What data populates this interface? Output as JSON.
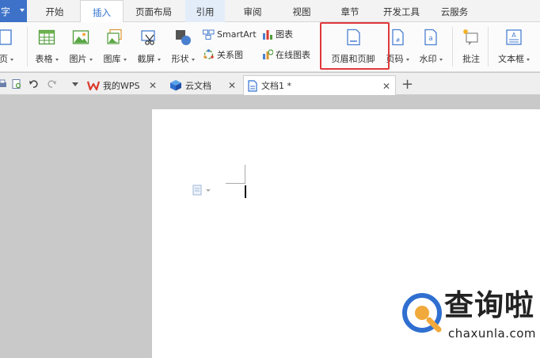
{
  "app_button": {
    "label": "字"
  },
  "menu_tabs": [
    "开始",
    "插入",
    "页面布局",
    "引用",
    "审阅",
    "视图",
    "章节",
    "开发工具",
    "云服务"
  ],
  "ribbon": {
    "page_label": "页",
    "table_label": "表格",
    "picture_label": "图片",
    "gallery_label": "图库",
    "screenshot_label": "截屏",
    "shapes_label": "形状",
    "smartart_label": "SmartArt",
    "relation_label": "关系图",
    "chart_label": "图表",
    "online_chart_label": "在线图表",
    "header_footer_label": "页眉和页脚",
    "page_number_label": "页码",
    "watermark_label": "水印",
    "comment_label": "批注",
    "textbox_label": "文本框"
  },
  "doc_tabs": {
    "tab1": "我的WPS",
    "tab2": "云文档",
    "tab3": "文档1 *"
  },
  "watermark": {
    "brand": "查询啦",
    "domain": "chaxunla.com"
  },
  "colors": {
    "accent": "#2f6fd0",
    "highlight_frame": "#e0383b",
    "wps_red": "#d93a2f"
  }
}
